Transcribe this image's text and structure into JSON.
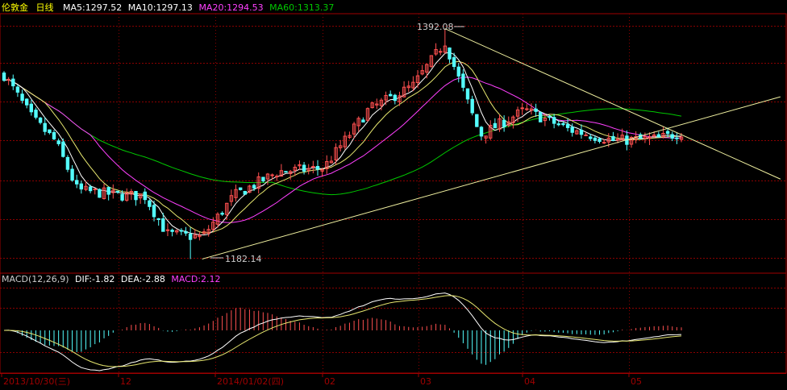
{
  "header": {
    "instrument": "伦敦金",
    "period": "日线",
    "ma5": "MA5:1297.52",
    "ma10": "MA10:1297.13",
    "ma20": "MA20:1294.53",
    "ma60": "MA60:1313.37"
  },
  "macd_header": {
    "params": "MACD(12,26,9)",
    "dif": "DIF:-1.82",
    "dea": "DEA:-2.88",
    "macd": "MACD:2.12"
  },
  "annotations": {
    "high_label": "1392.08",
    "low_label": "1182.14"
  },
  "x_axis": {
    "ticks": [
      "2013/10/30(三)",
      "12",
      "2014/01/02(四)",
      "02",
      "03",
      "04",
      "05"
    ]
  },
  "colors": {
    "background": "#000000",
    "frame": "#a00000",
    "up_candle": "#ff5050",
    "down_candle": "#54ffff",
    "ma5": "#ffffff",
    "ma10": "#e8e870",
    "ma20": "#ff40ff",
    "ma60": "#00c800",
    "trendline": "#f0f0a0",
    "header_ma20": "#ff40ff",
    "header_ma60": "#00c800",
    "header_macd": "#ff40ff"
  },
  "chart_data": {
    "type": "candlestick",
    "title": "伦敦金 日线",
    "price_range_estimate": [
      1170,
      1405
    ],
    "highest": 1392.08,
    "lowest": 1182.14,
    "trendlines": [
      {
        "from_date": "2013-12-31",
        "from_price": 1182.14,
        "to_date": "2014-06-30",
        "to_price": 1330
      },
      {
        "from_date": "2014-03-17",
        "from_price": 1392.08,
        "to_date": "2014-06-30",
        "to_price": 1255
      }
    ],
    "close_path_approx": [
      [
        "2013-10-30",
        1350
      ],
      [
        "2013-11-08",
        1310
      ],
      [
        "2013-11-15",
        1290
      ],
      [
        "2013-11-22",
        1245
      ],
      [
        "2013-12-06",
        1240
      ],
      [
        "2013-12-13",
        1240
      ],
      [
        "2013-12-20",
        1205
      ],
      [
        "2013-12-31",
        1202
      ],
      [
        "2014-01-10",
        1240
      ],
      [
        "2014-01-24",
        1262
      ],
      [
        "2014-02-07",
        1265
      ],
      [
        "2014-02-21",
        1318
      ],
      [
        "2014-03-07",
        1340
      ],
      [
        "2014-03-17",
        1380
      ],
      [
        "2014-03-28",
        1295
      ],
      [
        "2014-04-11",
        1318
      ],
      [
        "2014-04-25",
        1300
      ],
      [
        "2014-05-09",
        1290
      ],
      [
        "2014-05-23",
        1292
      ],
      [
        "2014-05-30",
        1297.52
      ]
    ],
    "macd": {
      "fast": 12,
      "slow": 26,
      "signal": 9,
      "dif": -1.82,
      "dea": -2.88,
      "macd": 2.12
    }
  }
}
